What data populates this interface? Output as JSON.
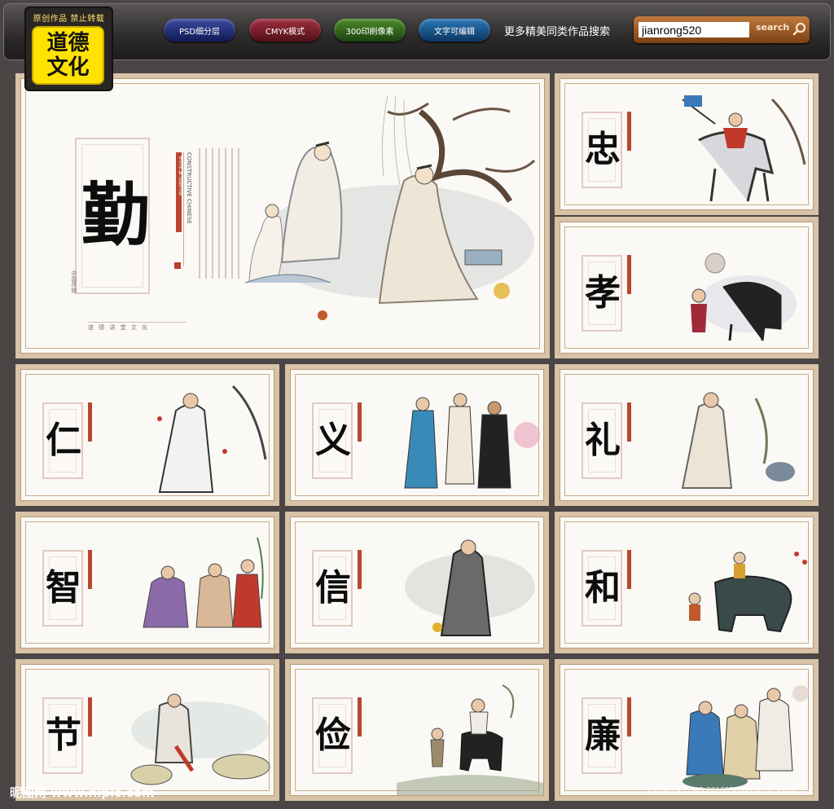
{
  "logo": {
    "top_text": "原创作品 禁止转载",
    "line1": "道德",
    "line2": "文化"
  },
  "toolbar": {
    "buttons": [
      {
        "label": "PSD细分层",
        "color": "blue"
      },
      {
        "label": "CMYK模式",
        "color": "red"
      },
      {
        "label": "300印刷像素",
        "color": "green"
      },
      {
        "label": "文字可编辑",
        "color": "cyan"
      }
    ],
    "search_label": "更多精美同类作品搜索",
    "search_value": "jianrong520",
    "search_button": "search"
  },
  "main_panel": {
    "char": "勤",
    "vertical_title": "中华传统 道德文化",
    "side_note": "中国传统",
    "english": "CONSTRUCTIVE CHINESE",
    "footer": "道 德 讲 堂 文 化"
  },
  "panels": [
    {
      "char": "忠"
    },
    {
      "char": "孝"
    },
    {
      "char": "仁"
    },
    {
      "char": "义"
    },
    {
      "char": "礼"
    },
    {
      "char": "智"
    },
    {
      "char": "信"
    },
    {
      "char": "和"
    },
    {
      "char": "节"
    },
    {
      "char": "俭"
    },
    {
      "char": "廉"
    }
  ],
  "watermark": {
    "site": "昵图网 www.nipic.com",
    "id": "ID:7942955 NO:20160520085413156000"
  },
  "colors": {
    "frame": "#d8c3a7",
    "accent_red": "#b9472e",
    "background": "#4b4545",
    "logo_yellow": "#ffe200"
  }
}
